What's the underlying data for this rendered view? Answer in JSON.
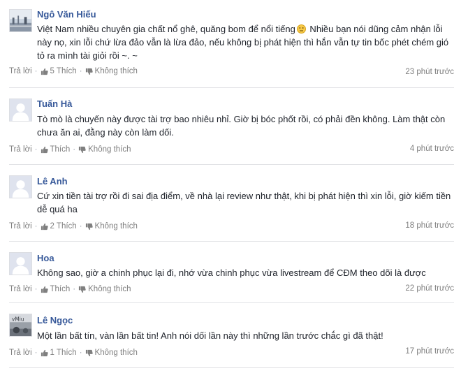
{
  "actions": {
    "reply_label": "Trả lời",
    "like_label": "Thích",
    "dislike_label": "Không thích",
    "separator": "·"
  },
  "comments": [
    {
      "author": "Ngô Văn Hiếu",
      "text_before_emoji": "Việt Nam nhiều chuyên gia chất nổ ghê, quăng bom để nổi tiếng",
      "emoji": "neutral-face-emoji",
      "text_after_emoji": " Nhiều bạn nói dũng cảm nhận lỗi này nọ, xin lỗi chứ lừa đảo vẫn là lừa đảo, nếu không bị phát hiện thì hắn vẫn tự tin bốc phét chém gió tỏ ra mình tài giỏi rồi ~. ~",
      "like_count": "5",
      "time": "23 phút trước",
      "avatar": "landscape-photo"
    },
    {
      "author": "Tuấn Hà",
      "text": "Tò mò là chuyến này được tài trợ bao nhiêu nhỉ. Giờ bị bóc phốt rồi, có phải đền không. Làm thật còn chưa ăn ai, đằng này còn làm dối.",
      "like_count": "",
      "time": "4 phút trước",
      "avatar": "default-silhouette"
    },
    {
      "author": "Lê Anh",
      "text": "Cứ xin tiền tài trợ rồi đi sai địa điểm, về nhà lại review như thật, khi bị phát hiện thì xin lỗi, giờ kiếm tiền dễ quá ha",
      "like_count": "2",
      "time": "18 phút trước",
      "avatar": "default-silhouette"
    },
    {
      "author": "Hoa",
      "text": "Không sao, giờ a chinh phục lại đi, nhớ vừa chinh phục vừa livestream để CĐM theo dõi là được",
      "like_count": "",
      "time": "22 phút trước",
      "avatar": "default-silhouette"
    },
    {
      "author": "Lê Ngọc",
      "text": "Một lần bất tín, vàn lần bất tin! Anh nói dối lần này thì những lần trước chắc gì đã thật!",
      "like_count": "1",
      "time": "17 phút trước",
      "avatar": "photo-thumbnail",
      "avatar_text": "vMiu"
    }
  ]
}
